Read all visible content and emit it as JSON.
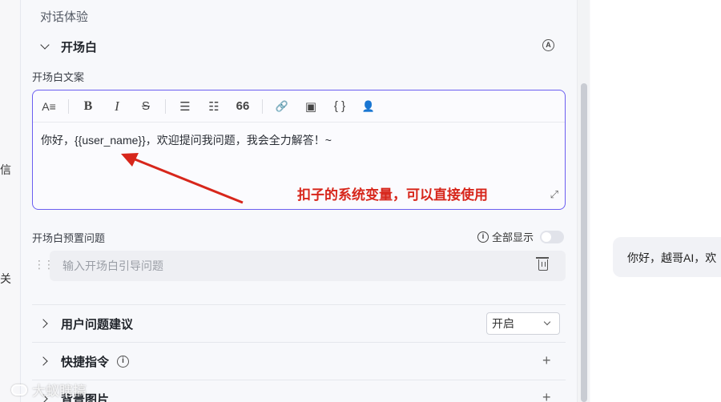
{
  "left_rail": {
    "fragment_1": "信",
    "fragment_2": "关"
  },
  "panel": {
    "section_title": "对话体验",
    "opening": {
      "header": "开场白",
      "auto_icon": "A",
      "copy_label": "开场白文案",
      "toolbar": {
        "heading": "A≡",
        "bold": "B",
        "italic": "I",
        "strike": "S",
        "bullet_list": "☰",
        "ordered_list": "☷",
        "quote": "66",
        "link": "🔗",
        "image": "▣",
        "code": "{ }",
        "user_var": "👤"
      },
      "editor_text": "你好，{{user_name}}，欢迎提问我问题，我会全力解答！~",
      "annotation": "扣子的系统变量，可以直接使用",
      "expand_icon": "⤢",
      "preset_label": "开场白预置问题",
      "show_all_label": "全部显示",
      "preset_placeholder": "输入开场白引导问题"
    },
    "suggestions": {
      "header": "用户问题建议",
      "select_value": "开启"
    },
    "shortcuts": {
      "header": "快捷指令"
    },
    "background": {
      "header": "背景图片"
    }
  },
  "preview": {
    "bubble_text": "你好，越哥AI，欢"
  },
  "watermark": {
    "text": "大蚁瞎搞"
  },
  "colors": {
    "accent": "#6a5ef0",
    "annotation": "#d7261b"
  }
}
